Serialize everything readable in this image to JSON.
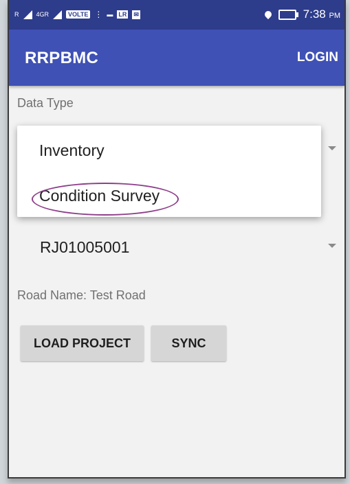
{
  "status_bar": {
    "signal1": "R",
    "network": "4GR",
    "volte": "VOLTE",
    "dots": "⋮",
    "app_icon_1": "LR",
    "time": "7:38",
    "ampm": "PM"
  },
  "app_bar": {
    "title": "RRPBMC",
    "login": "LOGIN"
  },
  "form": {
    "data_type_label": "Data Type",
    "dropdown_options": [
      "Inventory",
      "Condition Survey"
    ],
    "road_code": "RJ01005001",
    "road_name": "Road Name: Test Road"
  },
  "buttons": {
    "load_project": "LOAD PROJECT",
    "sync": "SYNC"
  },
  "colors": {
    "status_bar": "#2e3c8c",
    "app_bar": "#3f51b5",
    "highlight_circle": "#8e3f8a"
  }
}
